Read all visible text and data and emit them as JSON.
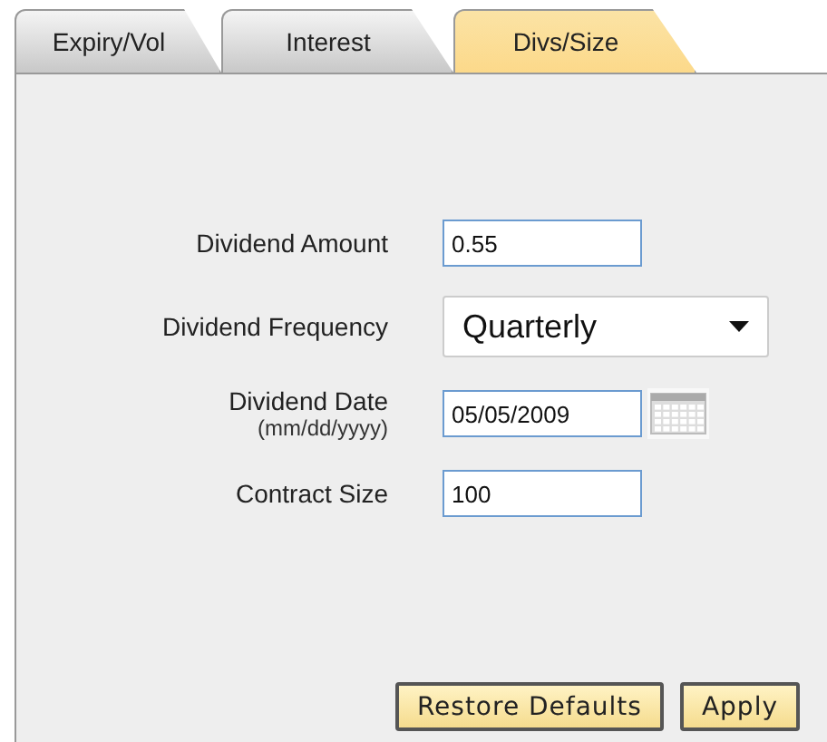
{
  "tabs": [
    {
      "label": "Expiry/Vol",
      "selected": false
    },
    {
      "label": "Interest",
      "selected": false
    },
    {
      "label": "Divs/Size",
      "selected": true
    }
  ],
  "fields": [
    {
      "kind": "text",
      "label": "Dividend Amount",
      "value": "0.55"
    },
    {
      "kind": "select",
      "label": "Dividend Frequency",
      "value": "Quarterly"
    },
    {
      "kind": "date",
      "label": "Dividend Date",
      "hint": "(mm/dd/yyyy)",
      "value": "05/05/2009"
    },
    {
      "kind": "text",
      "label": "Contract Size",
      "value": "100"
    }
  ],
  "buttons": [
    "Restore Defaults",
    "Apply"
  ]
}
